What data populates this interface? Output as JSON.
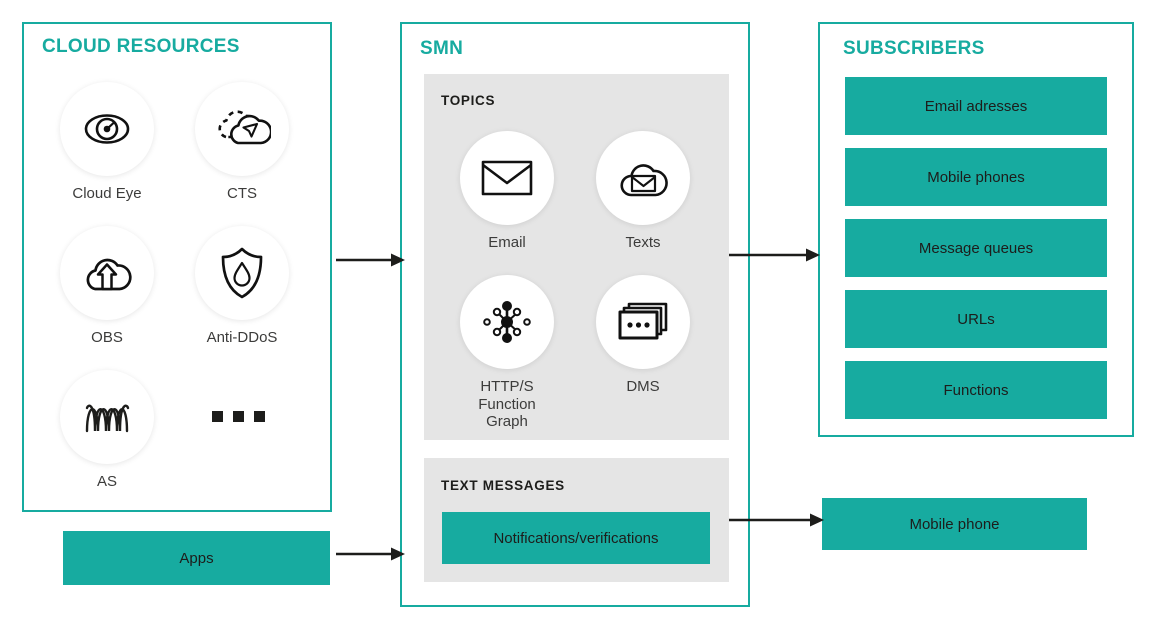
{
  "panels": {
    "cloud_resources": {
      "title": "CLOUD RESOURCES",
      "items": [
        {
          "label": "Cloud Eye",
          "icon": "eye-gauge-icon"
        },
        {
          "label": "CTS",
          "icon": "cloud-cursor-icon"
        },
        {
          "label": "OBS",
          "icon": "cloud-upload-icon"
        },
        {
          "label": "Anti-DDoS",
          "icon": "shield-droplet-icon"
        },
        {
          "label": "AS",
          "icon": "scaling-waves-icon"
        }
      ],
      "more_indicator": "…"
    },
    "smn": {
      "title": "SMN",
      "topics": {
        "title": "TOPICS",
        "items": [
          {
            "label": "Email",
            "icon": "envelope-icon"
          },
          {
            "label": "Texts",
            "icon": "cloud-envelope-icon"
          },
          {
            "label": "HTTP/S\nFunction Graph",
            "icon": "node-graph-icon"
          },
          {
            "label": "DMS",
            "icon": "message-stack-icon"
          }
        ]
      },
      "text_messages": {
        "title": "TEXT MESSAGES",
        "item": "Notifications/verifications"
      }
    },
    "subscribers": {
      "title": "SUBSCRIBERS",
      "items": [
        "Email adresses",
        "Mobile phones",
        "Message queues",
        "URLs",
        "Functions"
      ]
    }
  },
  "standalone_boxes": {
    "apps": "Apps",
    "mobile_phone": "Mobile phone"
  },
  "colors": {
    "teal": "#17aba0",
    "gray_box": "#e5e5e5",
    "ink": "#1d1d1b",
    "label": "#3c3c3b"
  }
}
